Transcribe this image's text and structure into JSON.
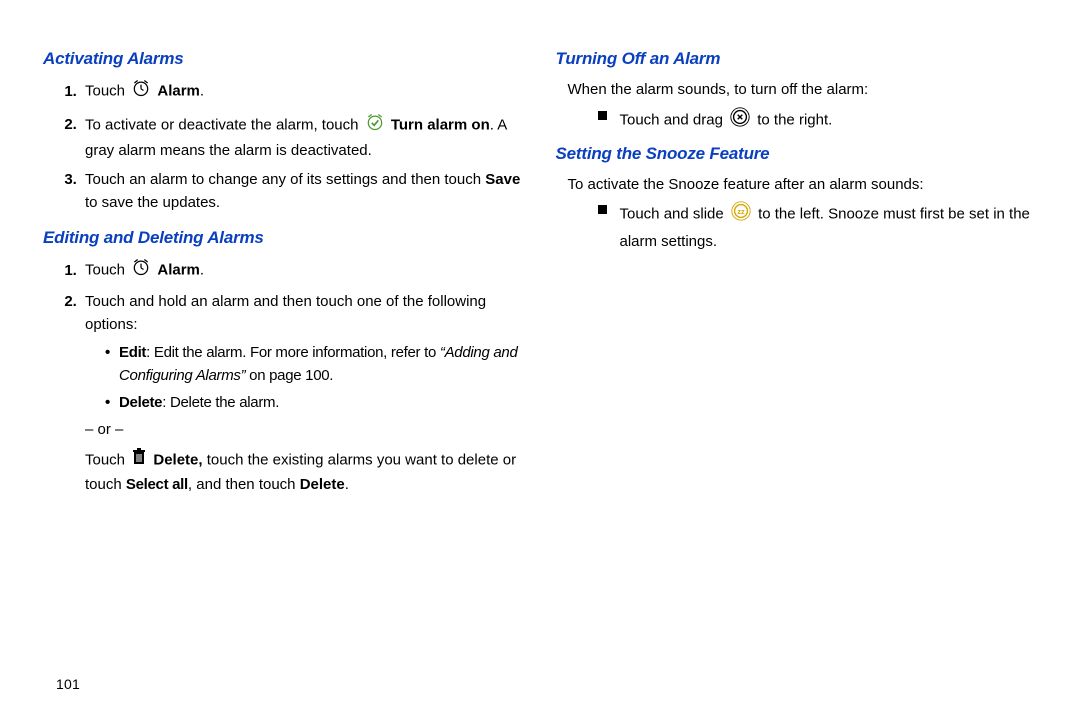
{
  "page_number": "101",
  "col1": {
    "h1": "Activating Alarms",
    "l1": {
      "step1_a": "Touch ",
      "step1_b": "Alarm",
      "step1_c": ".",
      "step2_a": "To activate or deactivate the alarm, touch ",
      "step2_b": "Turn alarm on",
      "step2_c": ". A gray alarm means the alarm is deactivated.",
      "step3_a": "Touch an alarm to change any of its settings and then touch ",
      "step3_b": "Save",
      "step3_c": " to save the updates."
    },
    "h2": "Editing and Deleting Alarms",
    "l2": {
      "step1_a": "Touch ",
      "step1_b": "Alarm",
      "step1_c": ".",
      "step2": "Touch and hold an alarm and then touch one of the following options:",
      "b1_a": "Edit",
      "b1_b": ": Edit the alarm. For more information, refer to ",
      "b1_c": "“Adding and Configuring Alarms”",
      "b1_d": " on page 100.",
      "b2_a": "Delete",
      "b2_b": ": Delete the alarm.",
      "or": "– or –",
      "after_a": "Touch ",
      "after_b": "Delete,",
      "after_c": " touch the existing alarms you want to delete or touch ",
      "after_d": "Select all",
      "after_e": ", and then touch ",
      "after_f": "Delete",
      "after_g": "."
    }
  },
  "col2": {
    "h1": "Turning Off an Alarm",
    "intro1": "When the alarm sounds, to turn off the alarm:",
    "b1_a": "Touch and drag ",
    "b1_b": " to the right.",
    "h2": "Setting the Snooze Feature",
    "intro2": "To activate the Snooze feature after an alarm sounds:",
    "b2_a": "Touch and slide ",
    "b2_b": " to the left. Snooze must first be set in the alarm settings."
  }
}
